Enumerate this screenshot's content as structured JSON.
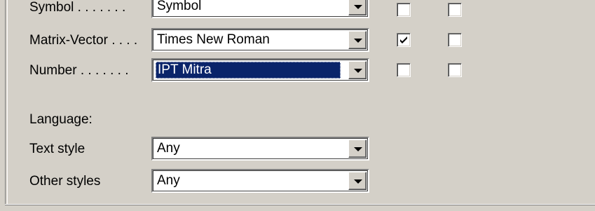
{
  "font_rows": [
    {
      "label": "Symbol . . . . . . .",
      "font": "Symbol",
      "check1": false,
      "check2": false,
      "selected": false
    },
    {
      "label": "Matrix-Vector . . . .",
      "font": "Times New Roman",
      "check1": true,
      "check2": false,
      "selected": false
    },
    {
      "label": "Number . . . . . . .",
      "font": "IPT Mitra",
      "check1": false,
      "check2": false,
      "selected": true
    }
  ],
  "language": {
    "heading": "Language:",
    "text_style_label": "Text style",
    "text_style_value": "Any",
    "other_styles_label": "Other styles",
    "other_styles_value": "Any"
  },
  "icons": {
    "dropdown": "chevron-down-icon",
    "check": "checkmark-icon"
  },
  "colors": {
    "dialog_bg": "#d4d0c8",
    "selection_bg": "#0a246a",
    "selection_text": "#ffffff"
  }
}
